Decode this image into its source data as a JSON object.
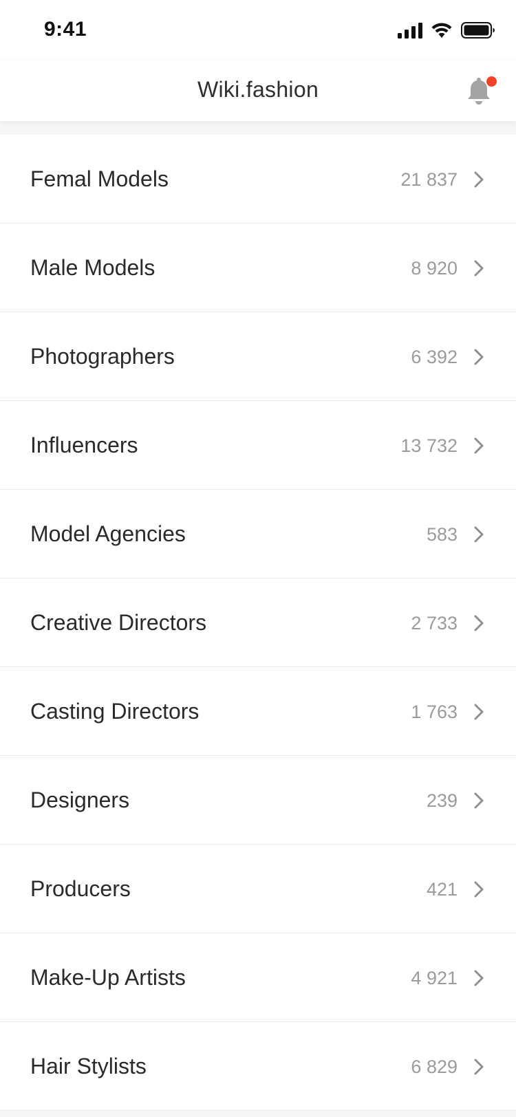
{
  "status_bar": {
    "time": "9:41",
    "icons": [
      "cellular-signal-icon",
      "wifi-icon",
      "battery-icon"
    ]
  },
  "header": {
    "title": "Wiki.fashion",
    "notification_icon": "bell-icon",
    "notification_badge_color": "#f0432a"
  },
  "categories": [
    {
      "label": "Femal Models",
      "count": "21 837"
    },
    {
      "label": "Male Models",
      "count": "8 920"
    },
    {
      "label": "Photographers",
      "count": "6 392"
    },
    {
      "label": "Influencers",
      "count": "13 732"
    },
    {
      "label": "Model Agencies",
      "count": "583"
    },
    {
      "label": "Creative Directors",
      "count": "2 733"
    },
    {
      "label": "Casting Directors",
      "count": "1 763"
    },
    {
      "label": "Designers",
      "count": "239"
    },
    {
      "label": "Producers",
      "count": "421"
    },
    {
      "label": "Make-Up Artists",
      "count": "4 921"
    },
    {
      "label": "Hair Stylists",
      "count": "6 829"
    }
  ],
  "colors": {
    "accent_badge": "#f0432a",
    "text_primary": "#2a2a2a",
    "text_secondary": "#9b9b9b"
  }
}
